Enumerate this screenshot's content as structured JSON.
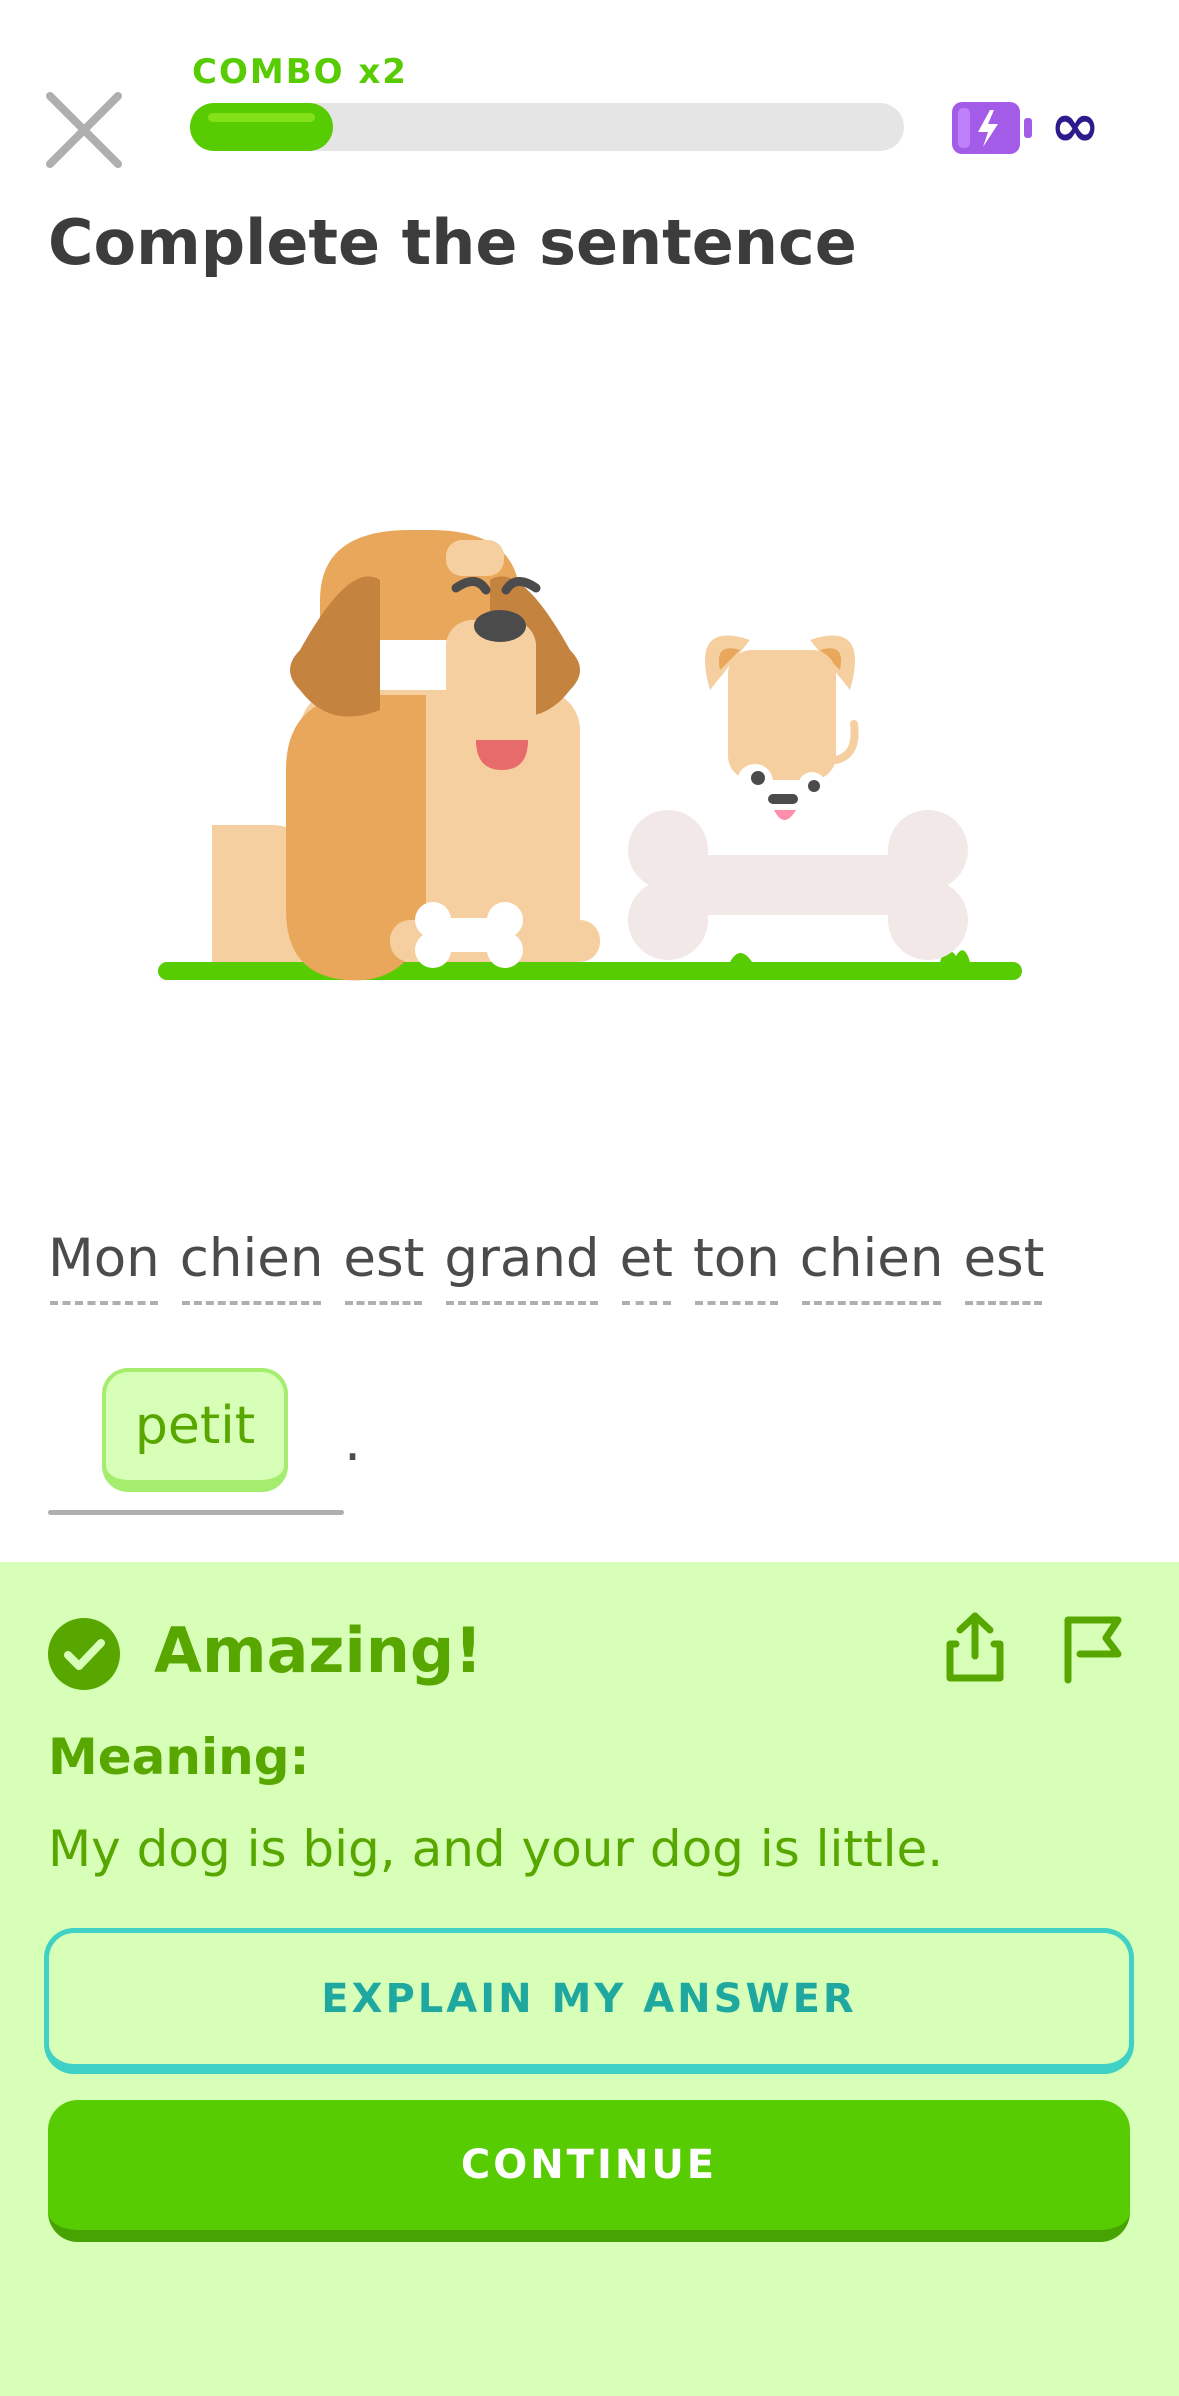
{
  "header": {
    "combo_label": "COMBO x2",
    "progress_fraction": 0.2,
    "energy_icon": "energy-battery-icon",
    "infinity_label": "∞"
  },
  "exercise": {
    "title": "Complete the sentence",
    "sentence_words": [
      "Mon",
      "chien",
      "est",
      "grand",
      "et",
      "ton",
      "chien",
      "est"
    ],
    "answer": "petit",
    "trailing_punctuation": "."
  },
  "feedback": {
    "headline": "Amazing!",
    "meaning_label": "Meaning:",
    "meaning_text": "My dog is big, and your dog is little.",
    "explain_button": "EXPLAIN MY ANSWER",
    "continue_button": "CONTINUE"
  },
  "colors": {
    "accent_green": "#58cc02",
    "feedback_bg": "#d7ffb8",
    "feedback_text": "#58a700",
    "explain_teal": "#3fd1c5",
    "energy_purple": "#a35ce8"
  }
}
